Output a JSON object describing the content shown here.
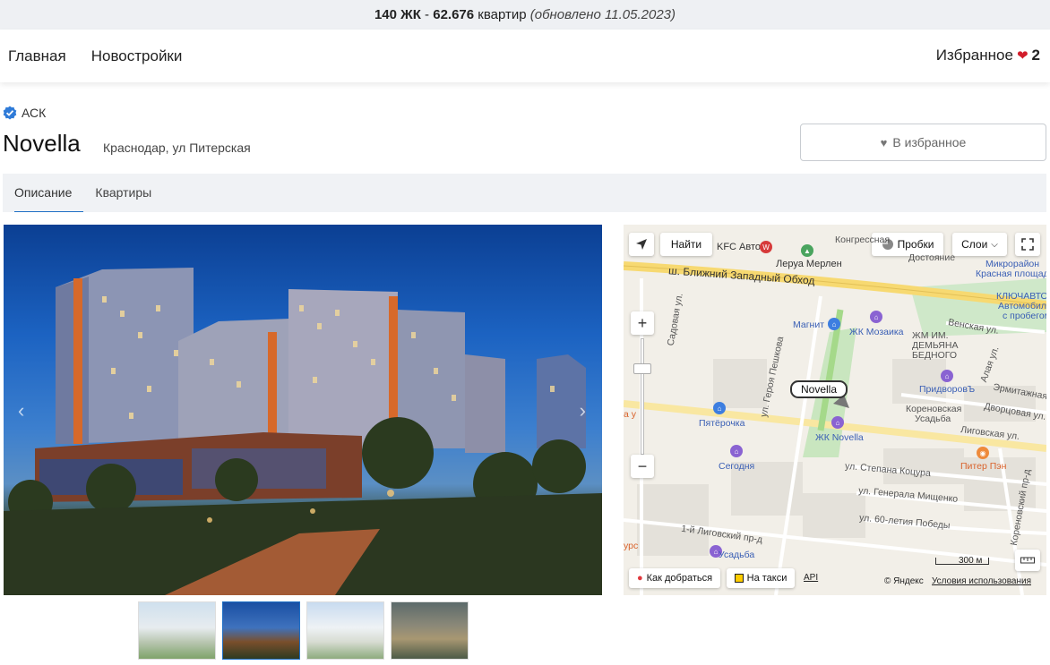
{
  "topbar": {
    "complexes": "140 ЖК",
    "sep": " - ",
    "apartments": "62.676",
    "apartments_word": " квартир ",
    "updated": "(обновлено 11.05.2023)"
  },
  "nav": {
    "items": [
      "Главная",
      "Новостройки"
    ],
    "favorites_label": "Избранное",
    "favorites_count": "2"
  },
  "developer": {
    "name": "АСК",
    "verified": true
  },
  "complex": {
    "title": "Novella",
    "address": "Краснодар, ул Питерская"
  },
  "fav_button": {
    "label": "В избранное"
  },
  "tabs": [
    {
      "label": "Описание",
      "active": true
    },
    {
      "label": "Квартиры",
      "active": false
    }
  ],
  "gallery": {
    "prev": "‹",
    "next": "›",
    "thumb_count": 4,
    "selected_index": 1
  },
  "map": {
    "find_label": "Найти",
    "traffic_label": "Пробки",
    "layers_label": "Слои",
    "marker_label": "Novella",
    "route_label": "Как добраться",
    "taxi_label": "На такси",
    "api_label": "API",
    "scale_label": "300 м",
    "copyright": "© Яндекс",
    "terms": "Условия использования",
    "labels": {
      "kfc": "KFC Авто",
      "leroy": "Леруа Мерлен",
      "kongress": "Конгрессная",
      "dostoyanie": "Достояние",
      "mikro": "Микрорайон",
      "krasnaya": "Красная площадь",
      "road": "ш. Ближний Западный Обход",
      "klyuch": "КЛЮЧАВТО",
      "avtomob": "Автомобили",
      "sprobeg": "с пробегом",
      "magnit": "Магнит",
      "mozaika": "ЖК Мозаика",
      "venskaya": "Венская ул.",
      "demyana1": "ЖМ ИМ.",
      "demyana2": "ДЕМЬЯНА",
      "demyana3": "БЕДНОГО",
      "pridvor": "ПридворовЪ",
      "ermit": "Эрмитажная ул",
      "pyaterochka": "Пятёрочка",
      "peshkova": "ул. Героя Пешкова",
      "korenovskaya": "Кореновская",
      "usadba": "Усадьба",
      "dvortsovaya": "Дворцовая ул.",
      "novella_poi": "ЖК Novella",
      "ligovskaya": "Лиговская ул.",
      "segodnya": "Сегодня",
      "piter": "Питер Пэн",
      "kotsura": "ул. Степана Коцура",
      "mischenko": "ул. Генерала Мищенко",
      "pobedy": "ул. 60-летия Победы",
      "ligovskiy": "1-й Лиговский пр-д",
      "usadba2": "Усадьба",
      "korenovskiy": "Кореновский пр-д",
      "sadovaya": "Садовая ул.",
      "alaya": "Алая ул.",
      "urs": "урс",
      "na_u": "а у"
    }
  }
}
